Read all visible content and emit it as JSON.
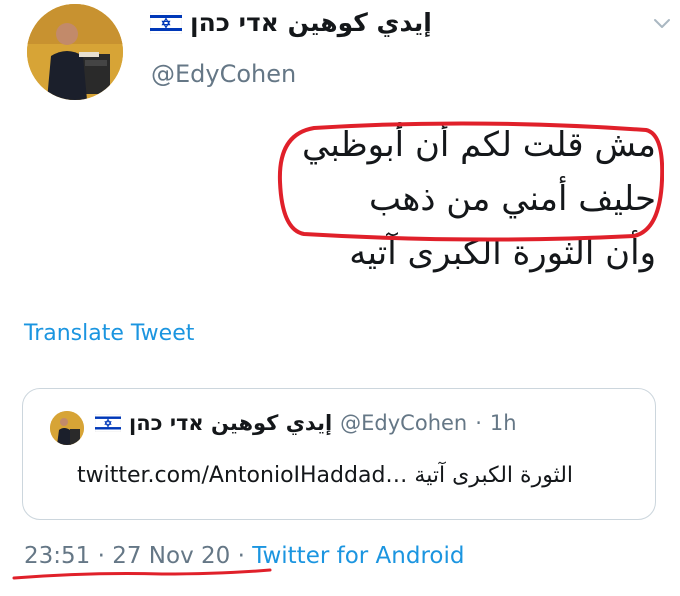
{
  "author": {
    "display_name": "إيدي كوهين אדי כהן",
    "handle": "@EdyCohen"
  },
  "tweet": {
    "lines": [
      "مش قلت لكم أن أبوظبي",
      "حليف أمني من ذهب",
      "وأن الثورة الكبرى آتيه"
    ],
    "translate_label": "Translate Tweet"
  },
  "quoted_tweet": {
    "display_name": "إيدي كوهين אדי כהן",
    "handle": "@EdyCohen",
    "separator": "·",
    "age": "1h",
    "text": "الثورة الكبرى آتية",
    "link": "twitter.com/AntonioIHaddad…"
  },
  "footer": {
    "time": "23:51",
    "separator": "·",
    "date": "27 Nov 20",
    "source": "Twitter for Android"
  },
  "icons": {
    "flag": "israel-flag-icon",
    "menu": "chevron-down-icon"
  },
  "colors": {
    "link": "#1b95e0",
    "secondary_text": "#657786",
    "annotation_red": "#e0202a"
  }
}
